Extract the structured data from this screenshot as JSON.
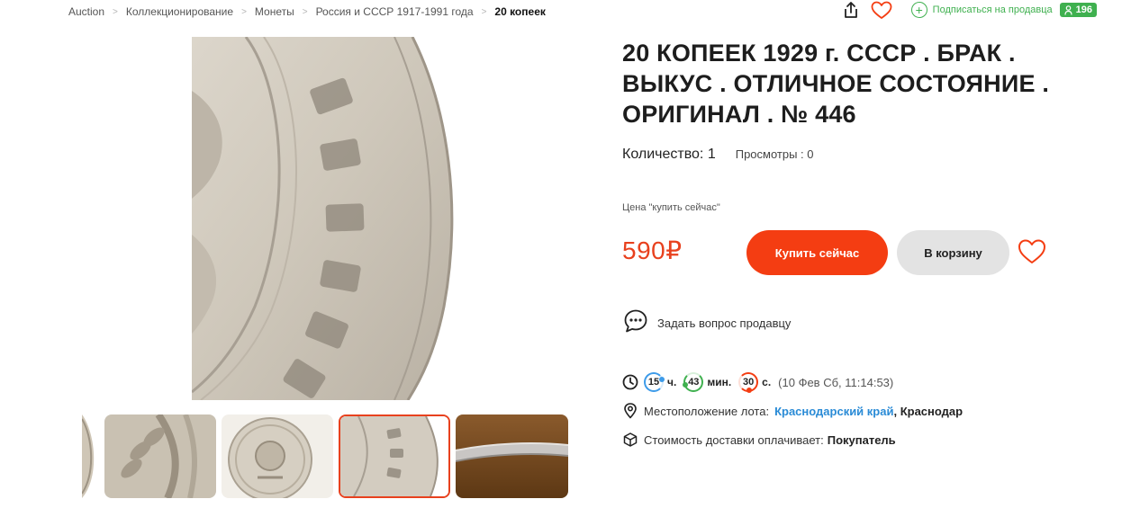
{
  "breadcrumb": {
    "items": [
      "Auction",
      "Коллекционирование",
      "Монеты",
      "Россия и СССР 1917-1991 года"
    ],
    "separator": ">",
    "current": "20 копеек"
  },
  "top_actions": {
    "share_icon": "share-icon",
    "favorite_icon": "heart-icon",
    "subscribe_label": "Подписаться на продавца",
    "rating": "196",
    "rating_icon": "user-icon"
  },
  "gallery": {
    "main_image": "coin-closeup-reverse-edge",
    "thumbnails": [
      {
        "name": "coin-edge-partial",
        "active": false
      },
      {
        "name": "coin-wheat-closeup",
        "active": false
      },
      {
        "name": "coin-obverse-emblem",
        "active": false
      },
      {
        "name": "coin-letters-closeup",
        "active": true
      },
      {
        "name": "coin-edge-rim",
        "active": false
      }
    ]
  },
  "lot": {
    "title": "20 КОПЕЕК 1929 г. СССР . БРАК . ВЫКУС . ОТЛИЧНОЕ СОСТОЯНИЕ . ОРИГИНАЛ . № 446",
    "quantity": "Количество: 1",
    "views": "Просмотры : 0",
    "price_caption": "Цена \"купить сейчас\"",
    "price": "590₽",
    "buy_label": "Купить сейчас",
    "cart_label": "В корзину",
    "ask_label": "Задать вопрос продавцу"
  },
  "timer": {
    "hours": "15",
    "hours_unit": "ч.",
    "minutes": "43",
    "minutes_unit": "мин.",
    "seconds": "30",
    "seconds_unit": "с.",
    "end_date": "(10 Фев Сб, 11:14:53)"
  },
  "location": {
    "label": "Местоположение лота:",
    "region": "Краснодарский край",
    "city": ", Краснодар"
  },
  "shipping": {
    "label": "Стоимость доставки оплачивает:",
    "payer": "Покупатель"
  },
  "colors": {
    "accent": "#f43d12",
    "green": "#3fb04f",
    "link": "#2a8bd6"
  }
}
